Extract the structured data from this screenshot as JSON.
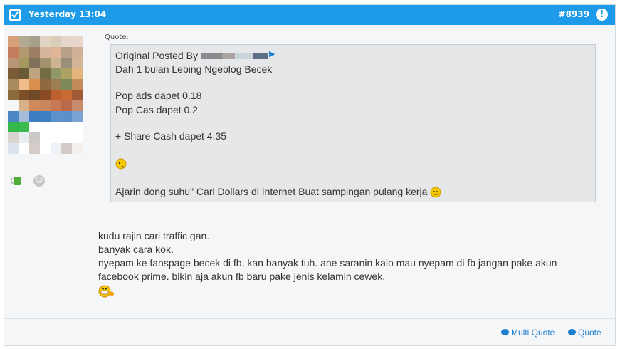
{
  "header": {
    "timestamp": "Yesterday 13:04",
    "post_number": "#8939",
    "alert_symbol": "!",
    "bg_color": "#1e9be8"
  },
  "sidebar": {
    "avatar_colors": [
      [
        "#d7a077",
        "#b3a890",
        "#a8a08b",
        "#e0d3c1",
        "#d9cdb8",
        "#e6d5cb",
        "#e8d6cb"
      ],
      [
        "#c67d5d",
        "#b2986f",
        "#9d7f66",
        "#d7b59c",
        "#dfb598",
        "#b8a189",
        "#cfb098"
      ],
      [
        "#b79575",
        "#a6995f",
        "#81715b",
        "#a4926f",
        "#cbb48f",
        "#9c8f7a",
        "#d2b596"
      ],
      [
        "#7a5b35",
        "#6b5a36",
        "#bda47f",
        "#746c43",
        "#8e9868",
        "#aea262",
        "#e3b57c"
      ],
      [
        "#a88a5d",
        "#f0bd8a",
        "#d98f4d",
        "#8e6a3e",
        "#9d7d52",
        "#7c8a5a",
        "#c18c5a"
      ],
      [
        "#8b6a3c",
        "#7d4f27",
        "#6e4a26",
        "#8a4b22",
        "#bd5f2f",
        "#c86a33",
        "#a15a36"
      ],
      [
        "#f6f6f6",
        "#d6b18a",
        "#cf8a5c",
        "#c9855b",
        "#c67952",
        "#b96a4b",
        "#c68b6a"
      ],
      [
        "#4d86c5",
        "#a4bcd8",
        "#3a7dc2",
        "#3c7fc3",
        "#5d91cb",
        "#5c90cb",
        "#7aa3d3"
      ],
      [
        "#35b84a",
        "#3cbc4e",
        "#ffffff",
        "#ffffff",
        "#ffffff",
        "#ffffff",
        "#ffffff"
      ],
      [
        "#d9d4cf",
        "#e8edf2",
        "#ccc8c5",
        "#ffffff",
        "#ffffff",
        "#ffffff",
        "#ffffff"
      ],
      [
        "#dbe4ee",
        "#ffffff",
        "#d5ccc9",
        "#ffffff",
        "#eef2f6",
        "#d3cac7",
        "#f3f0ee"
      ]
    ],
    "icon_1": "coffee-cup-icon",
    "icon_2": "neutral-face-icon",
    "icon_2_glyph": "☺"
  },
  "post": {
    "quote_label": "Quote:",
    "quote": {
      "posted_by": "Original Posted By",
      "lines": [
        "Dah 1 bulan Lebing Ngeblog Becek",
        "Pop ads dapet 0.18",
        "Pop Cas dapet 0.2",
        "+ Share Cash dapet 4,35",
        "Ajarin dong suhu\" Cari Dollars di Internet Buat sampingan pulang kerja"
      ]
    },
    "body_lines": [
      "kudu rajin cari traffic gan.",
      "banyak cara kok.",
      "nyepam ke fanspage becek di fb, kan banyak tuh. ane saranin kalo mau nyepam di fb jangan pake akun",
      "facebook prime. bikin aja akun fb baru pake jenis kelamin cewek."
    ]
  },
  "footer": {
    "multi_quote_label": "Multi Quote",
    "quote_label": "Quote",
    "link_color": "#1e7fd0"
  }
}
